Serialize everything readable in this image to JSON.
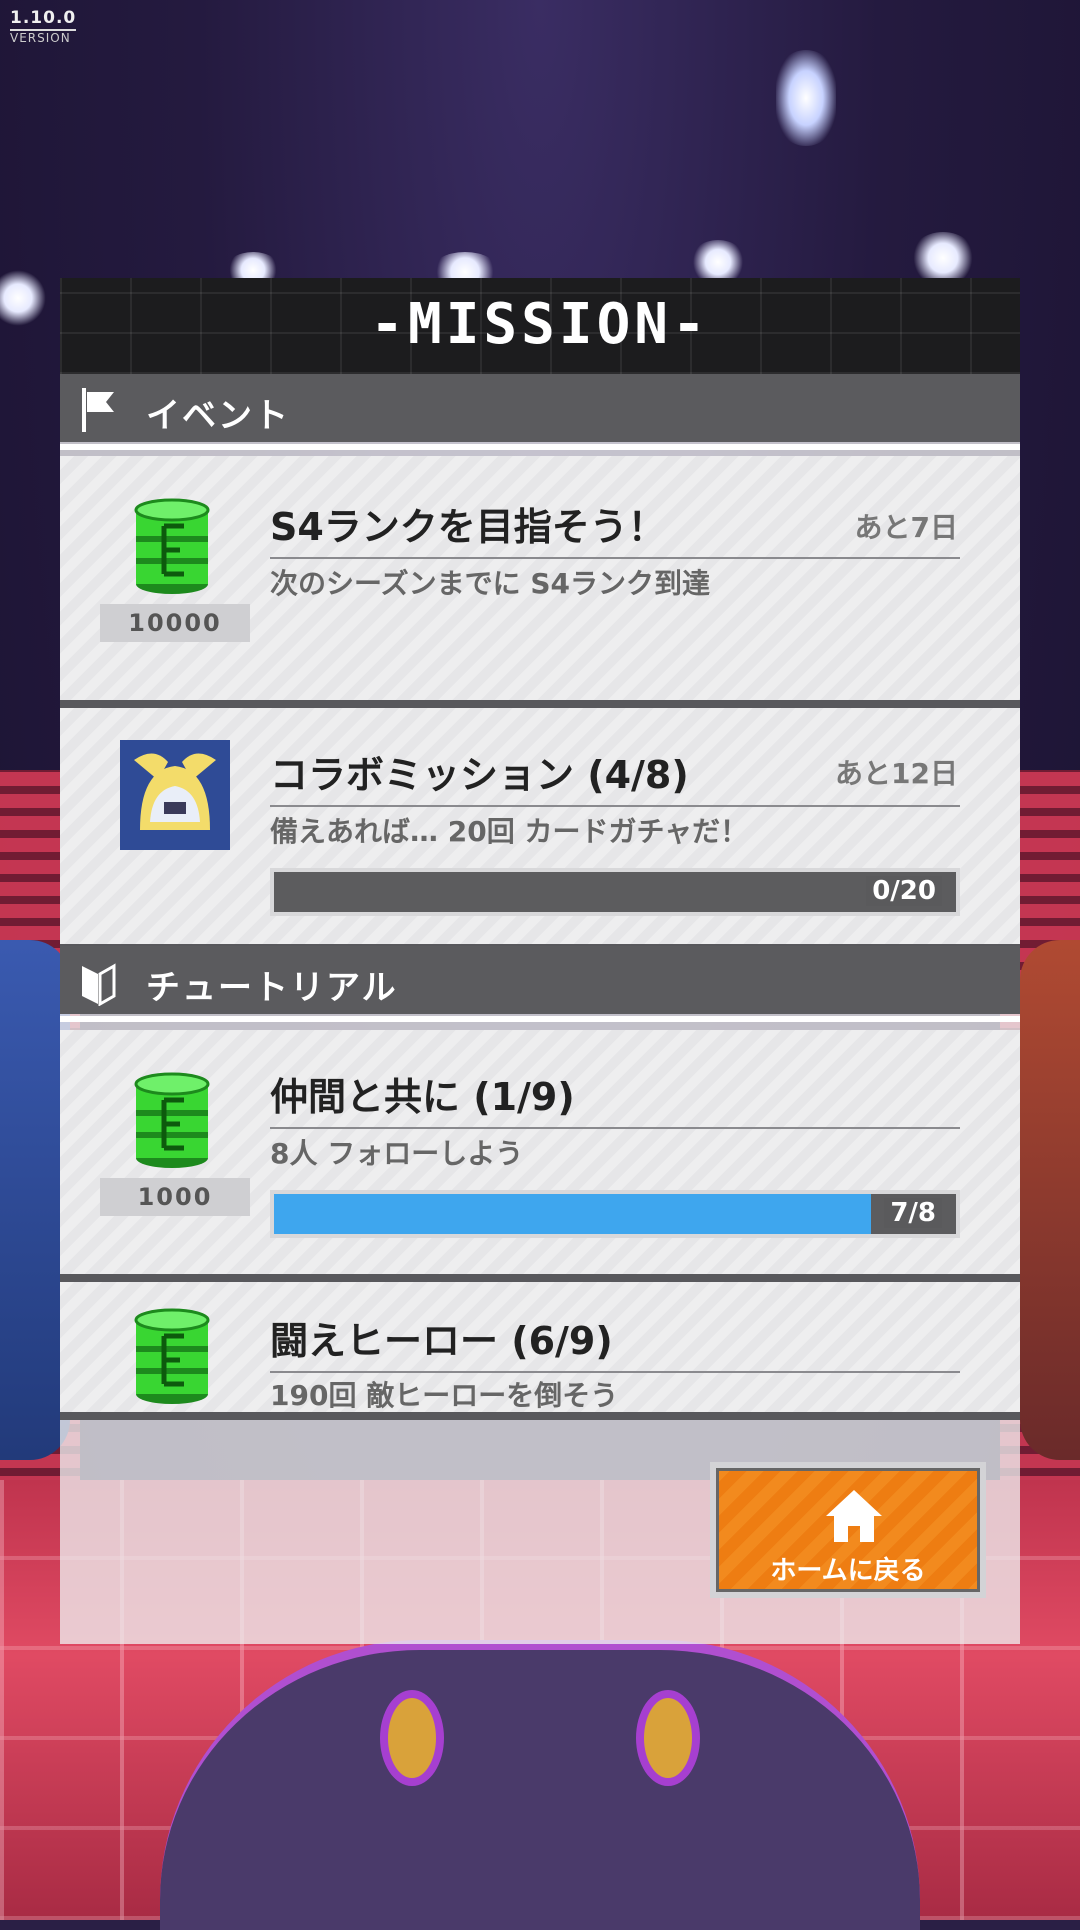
{
  "version": {
    "number": "1.10.0",
    "label": "VERSION"
  },
  "panel": {
    "title": "-MISSION-"
  },
  "sections": {
    "event": {
      "label": "イベント"
    },
    "tutorial": {
      "label": "チュートリアル"
    }
  },
  "missions": [
    {
      "title": "S4ランクを目指そう！",
      "remaining": "あと7日",
      "description": "次のシーズンまでに S4ランク到達",
      "reward_count": "10000",
      "reward_icon": "green-barrel-icon"
    },
    {
      "title": "コラボミッション (4/8)",
      "remaining": "あと12日",
      "description": "備えあれば… 20回 カードガチャだ！",
      "progress_text": "0/20",
      "progress": 0.0,
      "reward_icon": "character-avatar-icon"
    },
    {
      "title": "仲間と共に (1/9)",
      "description": "8人 フォローしよう",
      "reward_count": "1000",
      "progress_text": "7/8",
      "progress": 0.875,
      "reward_icon": "green-barrel-icon"
    },
    {
      "title": "闘えヒーロー (6/9)",
      "description": "190回 敵ヒーローを倒そう",
      "reward_icon": "green-barrel-icon"
    }
  ],
  "home_button": {
    "label": "ホームに戻る",
    "icon": "home-icon"
  },
  "colors": {
    "progress_fill": "#3ea6ee",
    "home_button": "#f28a1e",
    "reward_barrel": "#39d632"
  }
}
